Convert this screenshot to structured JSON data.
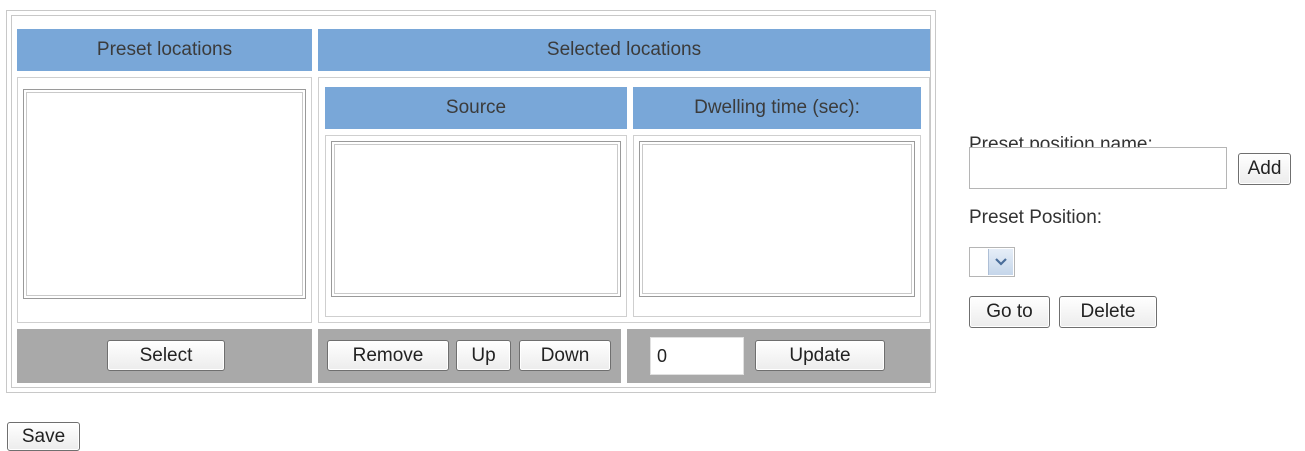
{
  "table": {
    "preset_header": "Preset locations",
    "selected_header": "Selected locations",
    "source_header": "Source",
    "dwelling_header": "Dwelling time (sec):",
    "select_label": "Select",
    "remove_label": "Remove",
    "up_label": "Up",
    "down_label": "Down",
    "dwell_value": "0",
    "update_label": "Update"
  },
  "side": {
    "preset_name_label": "Preset position name:",
    "preset_name_value": "",
    "add_label": "Add",
    "preset_position_label": "Preset Position:",
    "goto_label": "Go to",
    "delete_label": "Delete"
  },
  "save_label": "Save",
  "icons": {
    "dropdown": "chevron-down-icon"
  },
  "colors": {
    "header": "#79a7d8",
    "footer": "#a9a9a9"
  }
}
